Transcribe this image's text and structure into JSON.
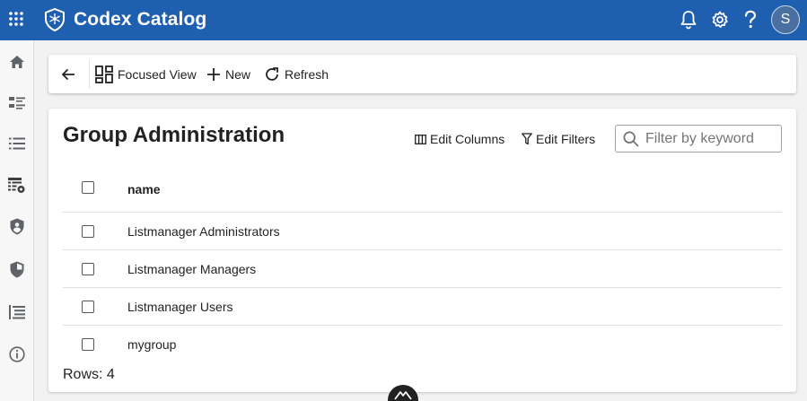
{
  "app": {
    "title": "Codex Catalog",
    "user_initial": "S"
  },
  "colors": {
    "topbar": "#1f5fb0",
    "accent": "#1f5fb0"
  },
  "topbar_icons": [
    "apps-grid-icon",
    "shield-logo-icon",
    "bell-icon",
    "gear-icon",
    "help-icon"
  ],
  "sidebar": {
    "items": [
      {
        "icon": "home-icon"
      },
      {
        "icon": "list-detail-icon"
      },
      {
        "icon": "list-icon"
      },
      {
        "icon": "table-settings-icon"
      },
      {
        "icon": "shield-user-icon"
      },
      {
        "icon": "shield-icon"
      },
      {
        "icon": "list-indent-icon"
      },
      {
        "icon": "info-icon"
      }
    ]
  },
  "toolbar": {
    "focused_view_label": "Focused View",
    "new_label": "New",
    "refresh_label": "Refresh"
  },
  "page": {
    "title": "Group Administration",
    "edit_columns_label": "Edit Columns",
    "edit_filters_label": "Edit Filters",
    "search_placeholder": "Filter by keyword"
  },
  "table": {
    "columns": [
      "name"
    ],
    "rows": [
      {
        "name": "Listmanager Administrators"
      },
      {
        "name": "Listmanager Managers"
      },
      {
        "name": "Listmanager Users"
      },
      {
        "name": "mygroup"
      }
    ],
    "rows_label": "Rows: 4"
  }
}
